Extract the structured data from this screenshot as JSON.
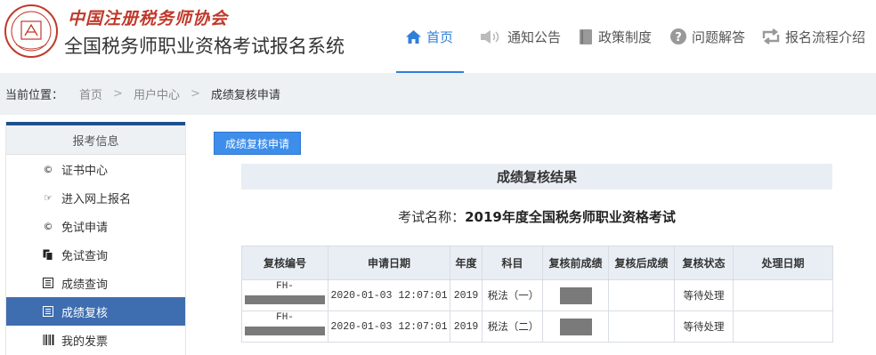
{
  "header": {
    "brand_top": "中国注册税务师协会",
    "system_title": "全国税务师职业资格考试报名系统",
    "nav": [
      {
        "label": "首页",
        "icon": "home-icon",
        "active": true
      },
      {
        "label": "通知公告",
        "icon": "speaker-icon",
        "active": false
      },
      {
        "label": "政策制度",
        "icon": "book-icon",
        "active": false
      },
      {
        "label": "问题解答",
        "icon": "question-icon",
        "active": false
      },
      {
        "label": "报名流程介绍",
        "icon": "process-arrows-icon",
        "active": false
      }
    ]
  },
  "breadcrumb": {
    "prefix": "当前位置：",
    "items": [
      "首页",
      "用户中心",
      "成绩复核申请"
    ]
  },
  "sidebar": {
    "title": "报考信息",
    "items": [
      {
        "label": "证书中心",
        "icon": "copyright-icon",
        "active": false
      },
      {
        "label": "进入网上报名",
        "icon": "hand-point-icon",
        "active": false
      },
      {
        "label": "免试申请",
        "icon": "copyright-icon",
        "active": false
      },
      {
        "label": "免试查询",
        "icon": "copy-icon",
        "active": false
      },
      {
        "label": "成绩查询",
        "icon": "list-icon",
        "active": false
      },
      {
        "label": "成绩复核",
        "icon": "list-icon",
        "active": true
      },
      {
        "label": "我的发票",
        "icon": "barcode-icon",
        "active": false
      }
    ]
  },
  "main": {
    "apply_button": "成绩复核申请",
    "result_title": "成绩复核结果",
    "exam_label": "考试名称：",
    "exam_name": "2019年度全国税务师职业资格考试",
    "columns": [
      "复核编号",
      "申请日期",
      "年度",
      "科目",
      "复核前成绩",
      "复核后成绩",
      "复核状态",
      "处理日期"
    ],
    "rows": [
      {
        "code_prefix": "FH-",
        "date": "2020-01-03 12:07:01",
        "year": "2019",
        "subject": "税法（一）",
        "before": "",
        "after": "",
        "status": "等待处理",
        "handled": ""
      },
      {
        "code_prefix": "FH-",
        "date": "2020-01-03 12:07:01",
        "year": "2019",
        "subject": "税法（二）",
        "before": "",
        "after": "",
        "status": "等待处理",
        "handled": ""
      }
    ]
  },
  "colors": {
    "accent": "#2f7fd8",
    "sidebar_active": "#3e6db0",
    "sidebar_top_bar": "#1f4f8f",
    "button": "#3d8eea",
    "brand_red": "#c0392b"
  }
}
